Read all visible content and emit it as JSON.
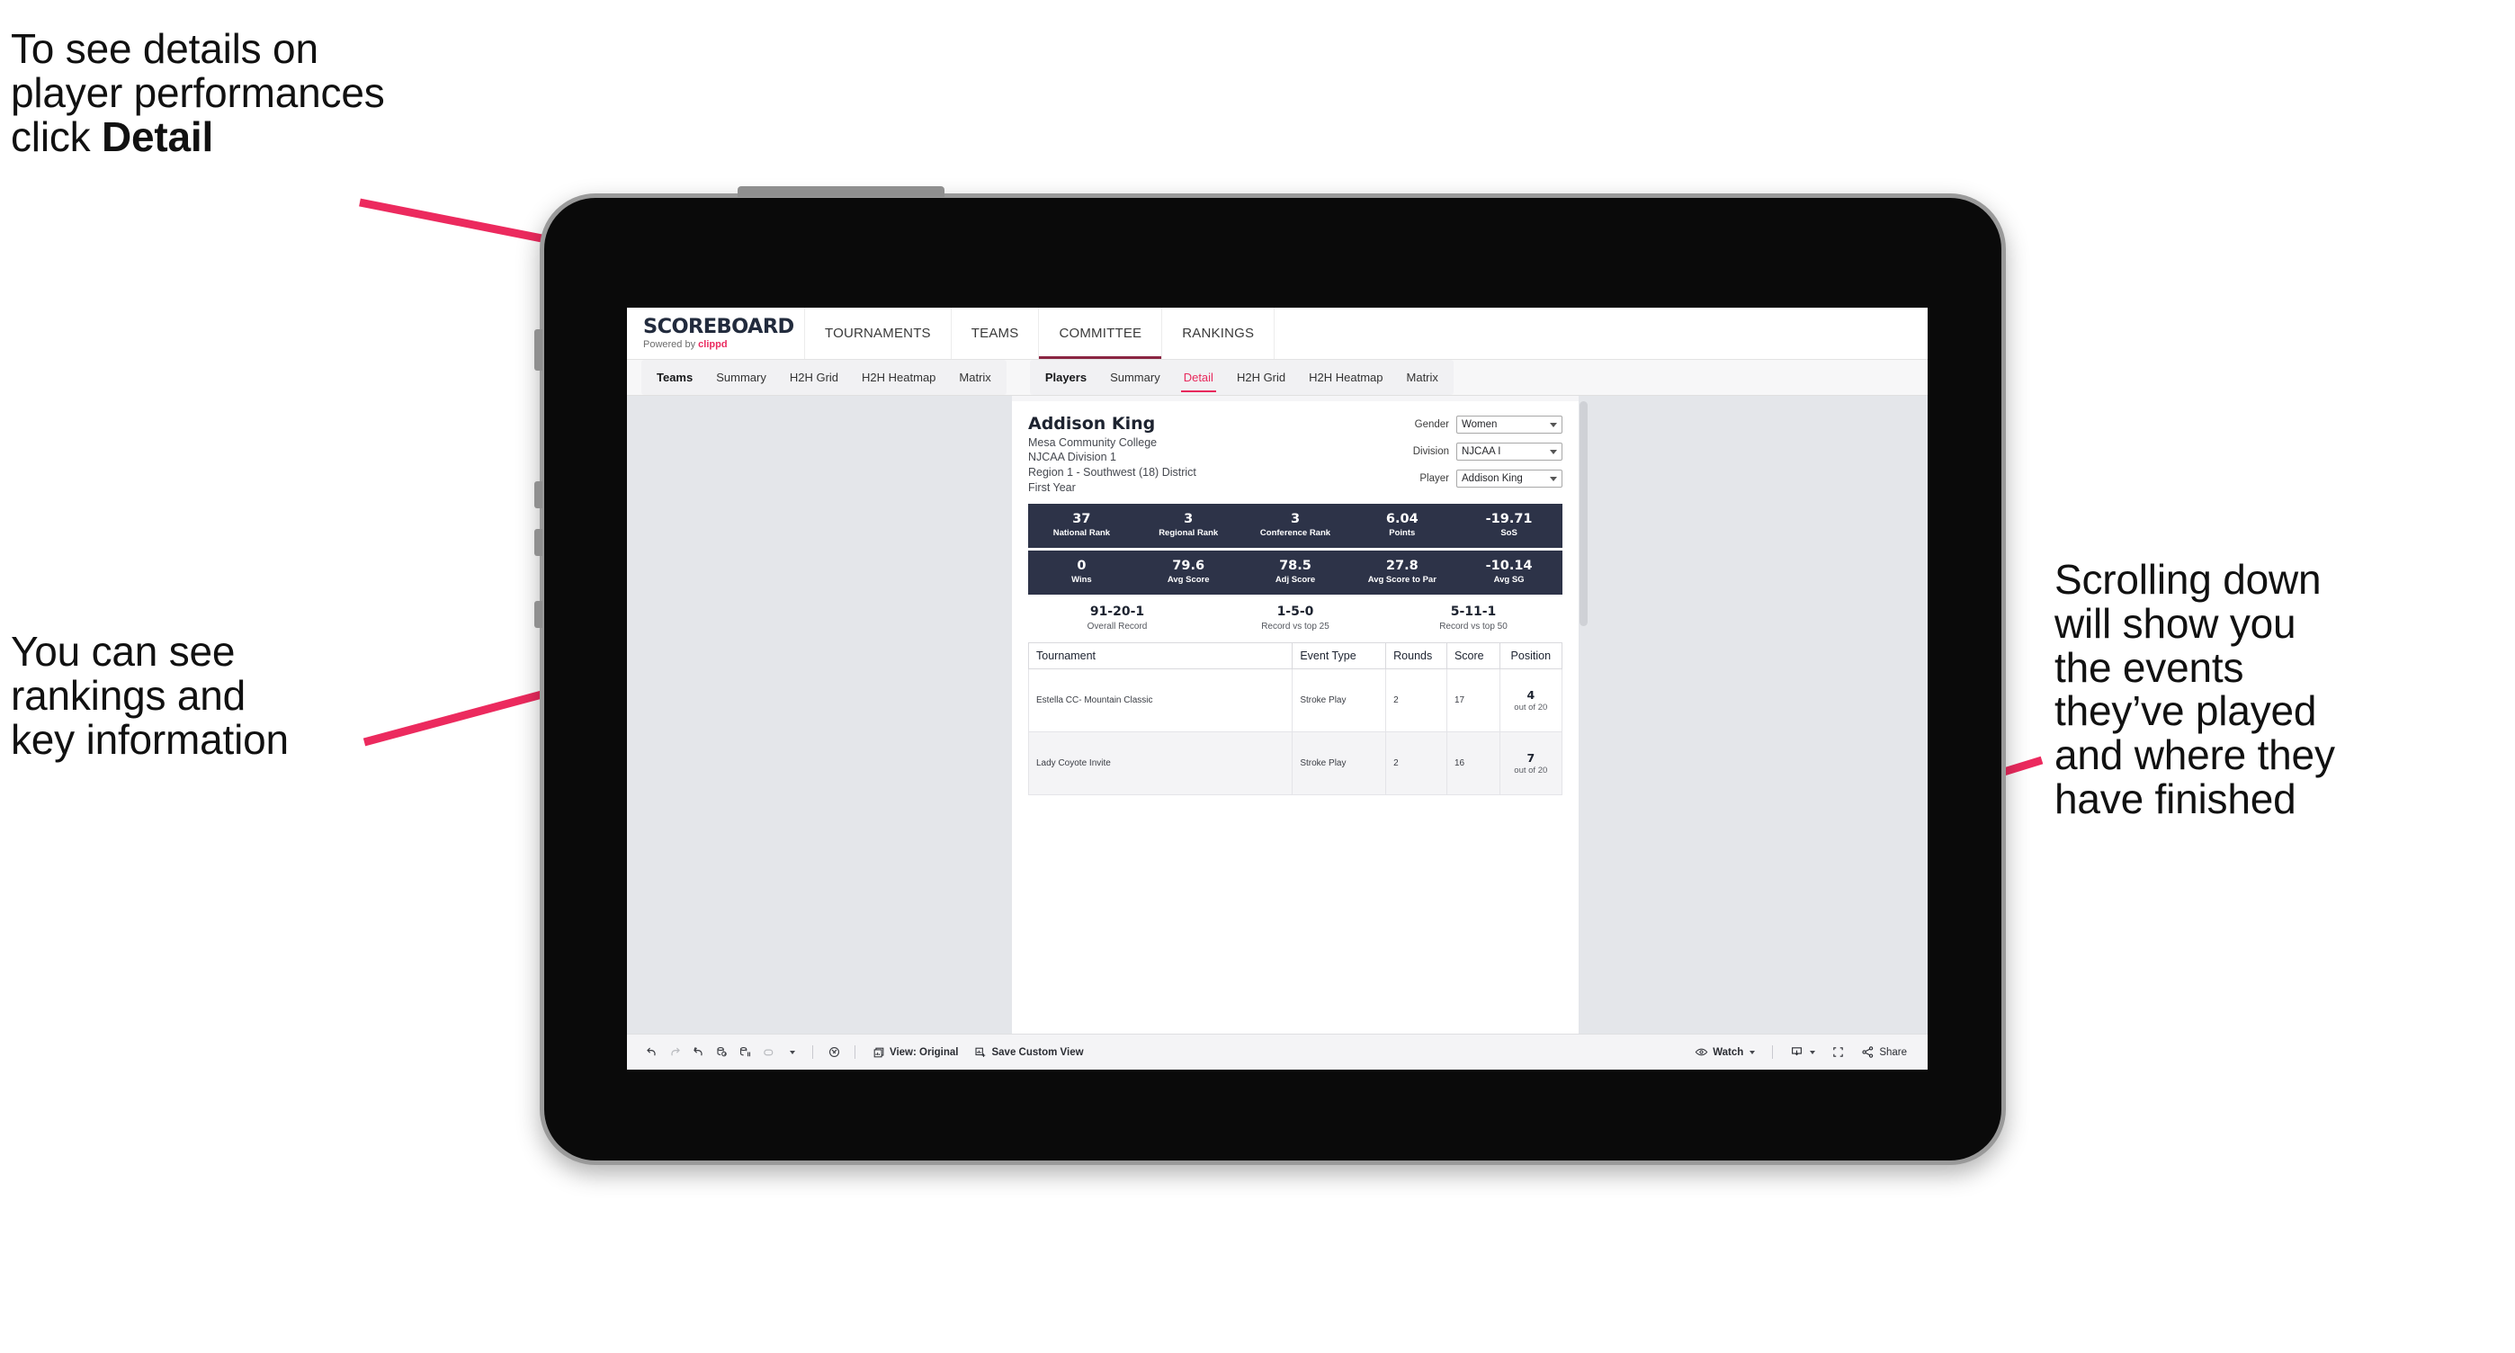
{
  "annotations": {
    "top_left": "To see details on\nplayer performances\nclick ",
    "top_left_bold": "Detail",
    "bottom_left": "You can see\nrankings and\nkey information",
    "right": "Scrolling down\nwill show you\nthe events\nthey’ve played\nand where they\nhave finished",
    "arrow_color": "#ec2a5e"
  },
  "app": {
    "brand": {
      "title": "SCOREBOARD",
      "powered_prefix": "Powered by ",
      "powered_name": "clippd"
    },
    "top_nav": [
      {
        "label": "TOURNAMENTS",
        "active": false
      },
      {
        "label": "TEAMS",
        "active": false
      },
      {
        "label": "COMMITTEE",
        "active": true
      },
      {
        "label": "RANKINGS",
        "active": false
      }
    ],
    "sub_nav": {
      "teams_group": [
        {
          "label": "Teams",
          "is_group_label": true
        },
        {
          "label": "Summary",
          "active": false
        },
        {
          "label": "H2H Grid",
          "active": false
        },
        {
          "label": "H2H Heatmap",
          "active": false
        },
        {
          "label": "Matrix",
          "active": false
        }
      ],
      "players_group": [
        {
          "label": "Players",
          "is_group_label": true
        },
        {
          "label": "Summary",
          "active": false
        },
        {
          "label": "Detail",
          "active": true
        },
        {
          "label": "H2H Grid",
          "active": false
        },
        {
          "label": "H2H Heatmap",
          "active": false
        },
        {
          "label": "Matrix",
          "active": false
        }
      ]
    },
    "player": {
      "name": "Addison King",
      "school": "Mesa Community College",
      "division": "NJCAA Division 1",
      "region": "Region 1 - Southwest (18) District",
      "year": "First Year"
    },
    "filters": [
      {
        "label": "Gender",
        "value": "Women"
      },
      {
        "label": "Division",
        "value": "NJCAA I"
      },
      {
        "label": "Player",
        "value": "Addison King"
      }
    ],
    "stats_row_1": [
      {
        "value": "37",
        "label": "National Rank"
      },
      {
        "value": "3",
        "label": "Regional Rank"
      },
      {
        "value": "3",
        "label": "Conference Rank"
      },
      {
        "value": "6.04",
        "label": "Points"
      },
      {
        "value": "-19.71",
        "label": "SoS"
      }
    ],
    "stats_row_2": [
      {
        "value": "0",
        "label": "Wins"
      },
      {
        "value": "79.6",
        "label": "Avg Score"
      },
      {
        "value": "78.5",
        "label": "Adj Score"
      },
      {
        "value": "27.8",
        "label": "Avg Score to Par"
      },
      {
        "value": "-10.14",
        "label": "Avg SG"
      }
    ],
    "records": [
      {
        "value": "91-20-1",
        "label": "Overall Record"
      },
      {
        "value": "1-5-0",
        "label": "Record vs top 25"
      },
      {
        "value": "5-11-1",
        "label": "Record vs top 50"
      }
    ],
    "events_table": {
      "columns": [
        "Tournament",
        "Event Type",
        "Rounds",
        "Score",
        "Position"
      ],
      "rows": [
        {
          "tournament": "Estella CC- Mountain Classic",
          "event_type": "Stroke Play",
          "rounds": "2",
          "score": "17",
          "position": "4",
          "position_sub": "out of 20"
        },
        {
          "tournament": "Lady Coyote Invite",
          "event_type": "Stroke Play",
          "rounds": "2",
          "score": "16",
          "position": "7",
          "position_sub": "out of 20"
        }
      ]
    },
    "bottom_toolbar": {
      "icons": [
        "undo-icon",
        "redo-icon",
        "revert-icon",
        "refresh-data-icon",
        "pause-updates-icon",
        "pause-dropdown-icon",
        "highlight-icon"
      ],
      "items": [
        {
          "name": "view-original",
          "label": "View: Original",
          "icon": "view-icon"
        },
        {
          "name": "save-custom-view",
          "label": "Save Custom View",
          "icon": "save-view-icon"
        },
        {
          "name": "watch",
          "label": "Watch",
          "icon": "eye-icon"
        },
        {
          "name": "download",
          "label": "",
          "icon": "download-icon"
        },
        {
          "name": "fullscreen",
          "label": "",
          "icon": "fullscreen-icon"
        },
        {
          "name": "share",
          "label": "Share",
          "icon": "share-icon"
        }
      ]
    },
    "colors": {
      "accent": "#e8295c",
      "navy": "#2d3348",
      "brand_navy": "#222b3d"
    }
  }
}
